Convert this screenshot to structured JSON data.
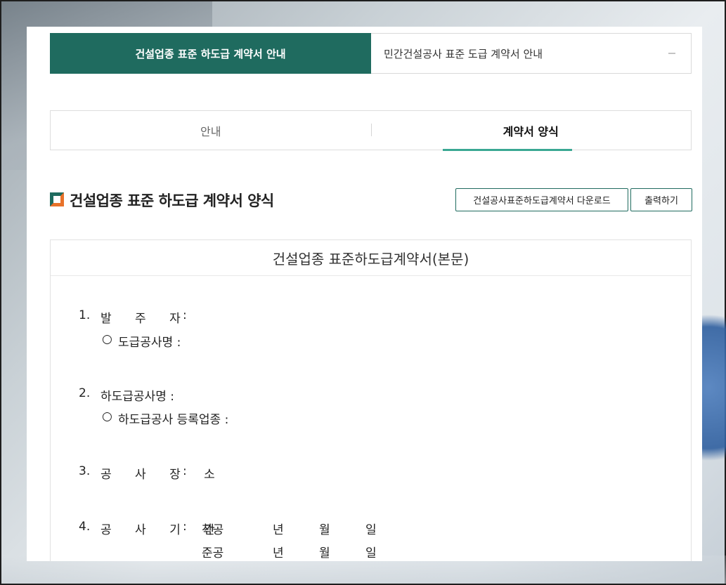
{
  "top_tabs": {
    "active": "건설업종 표준 하도급 계약서 안내",
    "other": "민간건설공사 표준 도급 계약서 안내"
  },
  "sub_tabs": {
    "guide": "안내",
    "form": "계약서 양식"
  },
  "section": {
    "title": "건설업종 표준 하도급 계약서 양식",
    "download_label": "건설공사표준하도급계약서 다운로드",
    "print_label": "출력하기"
  },
  "document": {
    "title": "건설업종 표준하도급계약서(본문)",
    "item1_num": "1.",
    "item1_label": "발 주 자",
    "item1_colon": ":",
    "item1_sub_bullet": "○",
    "item1_sub": "도급공사명 :",
    "item2_num": "2.",
    "item2_label": "하도급공사명 :",
    "item2_sub_bullet": "○",
    "item2_sub": "하도급공사 등록업종 :",
    "item3_num": "3.",
    "item3_label": "공 사 장 소",
    "item3_colon": ":",
    "item4_num": "4.",
    "item4_label": "공 사 기 간",
    "item4_colon": ":",
    "start_label": "착공",
    "end_label": "준공",
    "year": "년",
    "month": "월",
    "day": "일"
  },
  "colors": {
    "brand_green": "#1f6b5f",
    "tab_underline": "#3aa893",
    "icon_orange": "#e8722a"
  }
}
